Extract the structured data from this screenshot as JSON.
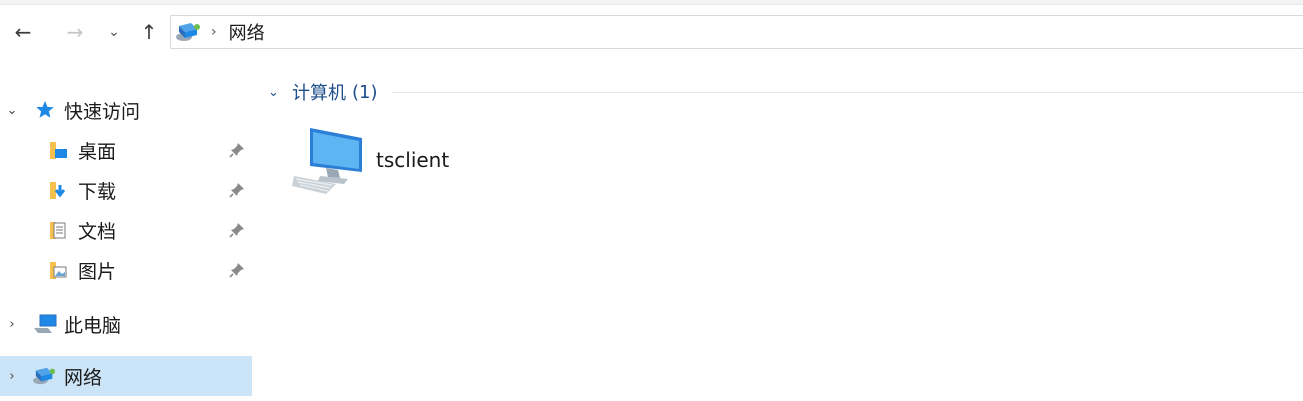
{
  "nav": {
    "back_icon": "←",
    "forward_icon": "→",
    "recent_icon": "⌄",
    "up_icon": "↑",
    "separator": "›"
  },
  "address": {
    "location": "网络"
  },
  "sidebar": {
    "quick_access": {
      "label": "快速访问",
      "expander": "⌄"
    },
    "pinned": [
      {
        "label": "桌面"
      },
      {
        "label": "下载"
      },
      {
        "label": "文档"
      },
      {
        "label": "图片"
      }
    ],
    "this_pc": {
      "label": "此电脑",
      "expander": "›"
    },
    "network": {
      "label": "网络",
      "expander": "›"
    }
  },
  "content": {
    "group": {
      "chevron": "⌄",
      "title": "计算机",
      "count": "(1)"
    },
    "items": [
      {
        "label": "tsclient"
      }
    ]
  },
  "colors": {
    "selection": "#cce4f7",
    "group_header": "#1e4e8c",
    "folder": "#f5c04e",
    "accent_blue": "#1e88e5"
  }
}
